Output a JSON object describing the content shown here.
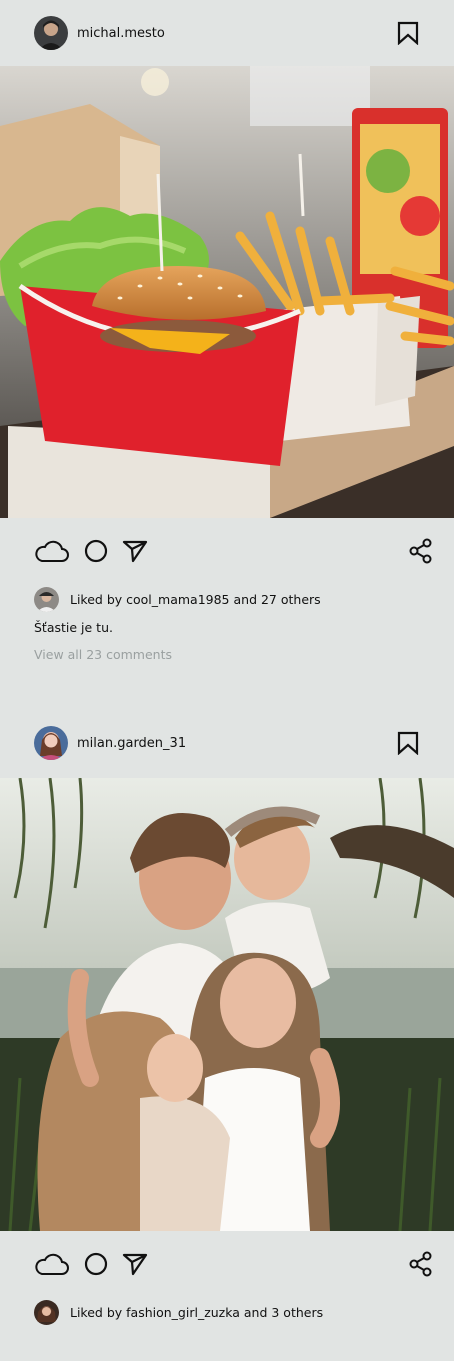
{
  "posts": [
    {
      "username": "michal.mesto",
      "likes": "Liked by cool_mama1985 and 27 others",
      "caption": "Šťastie je tu.",
      "comments_link": "View all 23 comments"
    },
    {
      "username": "milan.garden_31",
      "likes": "Liked by fashion_girl_zuzka and 3 others"
    }
  ],
  "icons": [
    "bookmark-icon",
    "like-cloud-icon",
    "comment-circle-icon",
    "send-arrow-icon",
    "share-icon"
  ]
}
